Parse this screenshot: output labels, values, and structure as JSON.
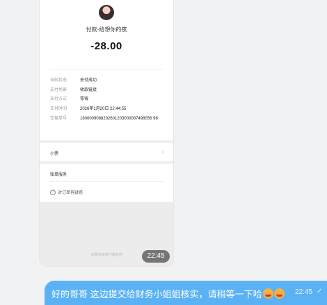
{
  "receipt": {
    "payee": "付款-给想你的夜",
    "amount": "-28.00",
    "details": [
      {
        "key": "当前状态",
        "value": "支付成功"
      },
      {
        "key": "支付场景",
        "value": "收款链接"
      },
      {
        "key": "支付方式",
        "value": "零钱"
      },
      {
        "key": "支付时间",
        "value": "2026年1月20日 22:44:55"
      },
      {
        "key": "交易单号",
        "value": "1800009088202601203000087498056 98"
      }
    ],
    "row_small_ticket": "小票",
    "section_bill_service": "账单服务",
    "question_link": "对订单有疑惑",
    "footer_note": "本服务由财付通提供",
    "photo_time": "22:45"
  },
  "message": {
    "text": "好的哥哥 这边提交给财务小姐姐核实，请稍等一下哈",
    "emoji": [
      "smiling-face-with-hearts",
      "smiling-face-with-hearts"
    ],
    "time": "22:45",
    "status_icon": "check-icon"
  }
}
